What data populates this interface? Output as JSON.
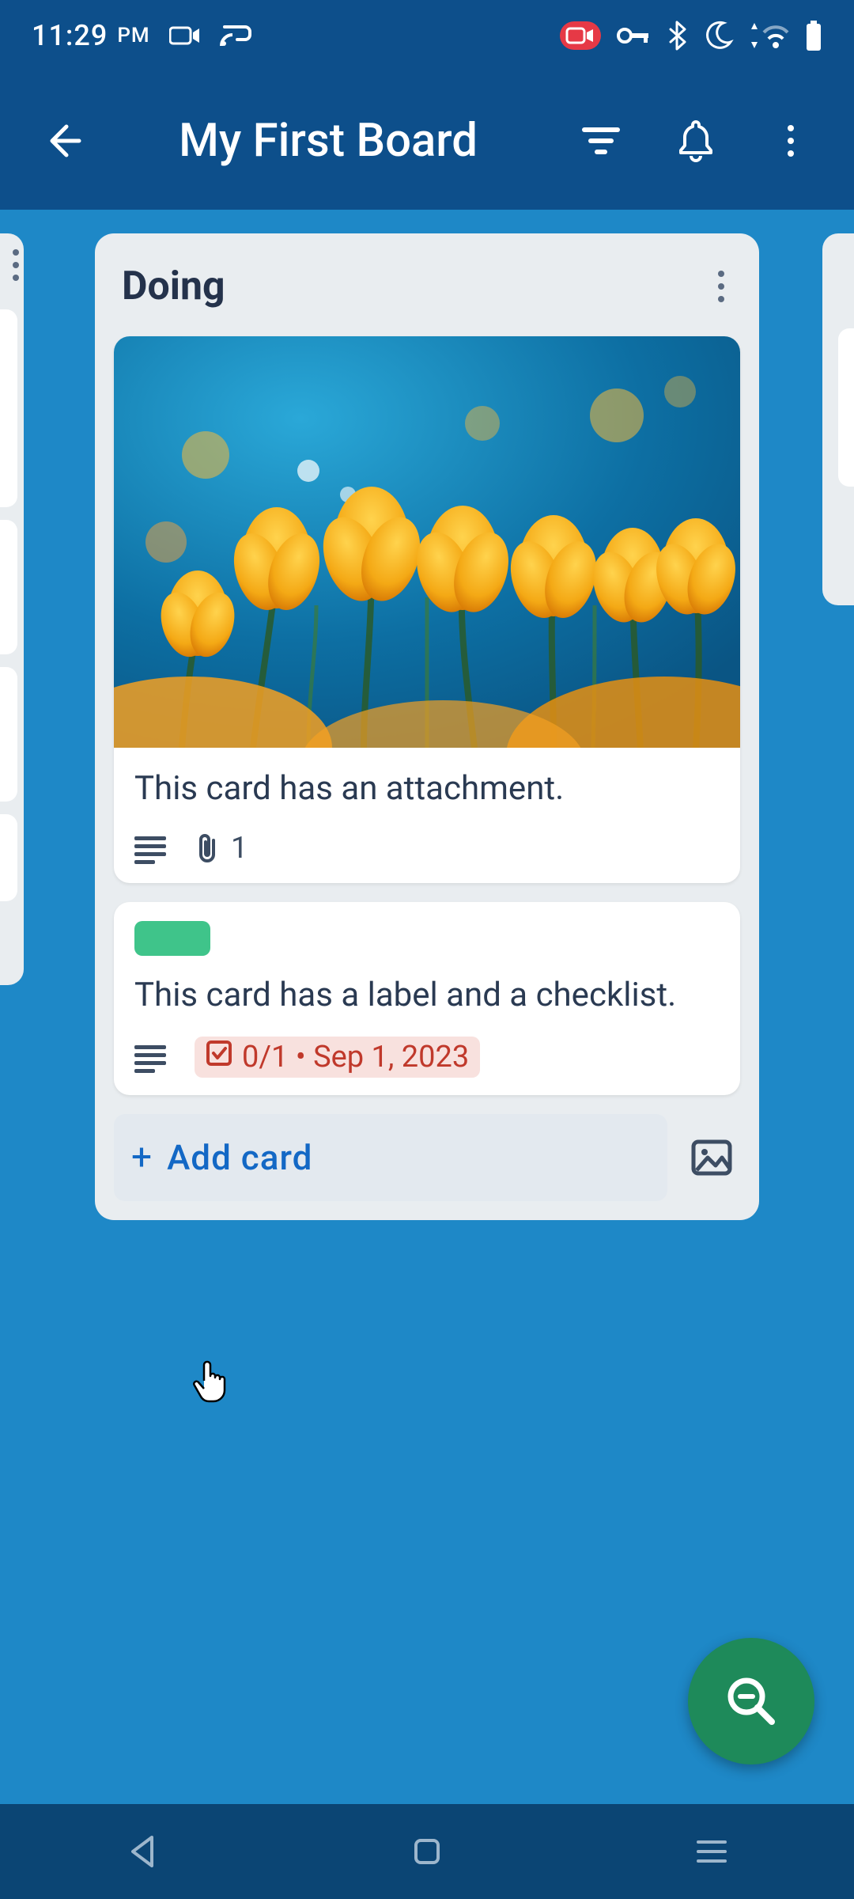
{
  "status": {
    "time": "11:29",
    "ampm": "PM"
  },
  "appbar": {
    "title": "My First Board"
  },
  "list": {
    "title": "Doing",
    "cards": [
      {
        "title": "This card has an attachment.",
        "attachment_count": "1"
      },
      {
        "title": "This card has a label and a checklist.",
        "label_color": "#3fc48a",
        "checklist_due": "0/1 • Sep 1, 2023"
      }
    ],
    "add_card_label": "Add card"
  }
}
